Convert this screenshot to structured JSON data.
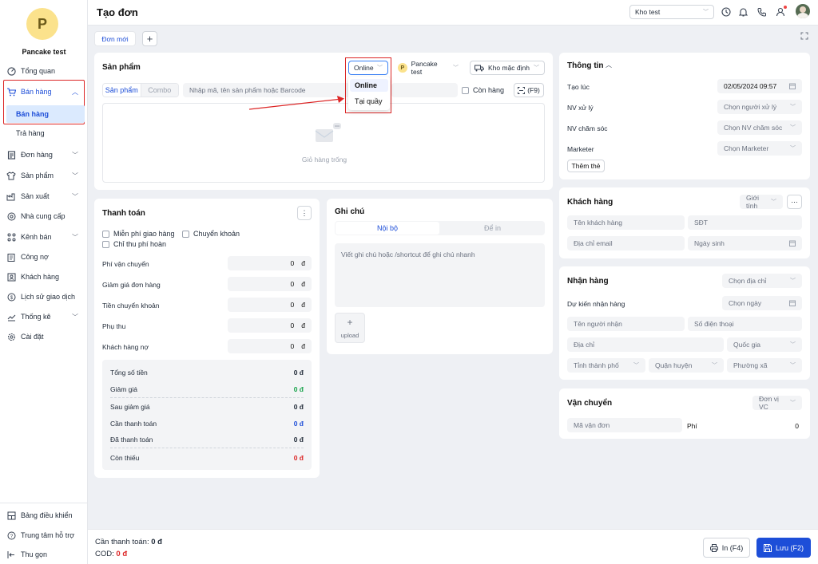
{
  "sidebar": {
    "avatar_letter": "P",
    "shop_name": "Pancake test",
    "items": [
      {
        "label": "Tổng quan"
      },
      {
        "label": "Bán hàng"
      },
      {
        "label": "Bán hàng"
      },
      {
        "label": "Trả hàng"
      },
      {
        "label": "Đơn hàng"
      },
      {
        "label": "Sản phẩm"
      },
      {
        "label": "Sản xuất"
      },
      {
        "label": "Nhà cung cấp"
      },
      {
        "label": "Kênh bán"
      },
      {
        "label": "Công nợ"
      },
      {
        "label": "Khách hàng"
      },
      {
        "label": "Lịch sử giao dịch"
      },
      {
        "label": "Thống kê"
      },
      {
        "label": "Cài đặt"
      }
    ],
    "bottom": [
      {
        "label": "Bảng điều khiển"
      },
      {
        "label": "Trung tâm hỗ trợ"
      },
      {
        "label": "Thu gọn"
      }
    ]
  },
  "header": {
    "title": "Tạo đơn",
    "warehouse": "Kho test"
  },
  "tabs": {
    "new_order": "Đơn mới",
    "add": "+"
  },
  "products": {
    "title": "Sản phẩm",
    "channel": "Online",
    "channel_options": [
      "Online",
      "Tại quầy"
    ],
    "shop": "Pancake test",
    "shop_letter": "P",
    "warehouse": "Kho mặc định",
    "tab_product": "Sản phẩm",
    "tab_combo": "Combo",
    "search_placeholder": "Nhập mã, tên sản phẩm hoặc Barcode",
    "in_stock": "Còn hàng",
    "scan_label": "(F9)",
    "empty_cart": "Giỏ hàng trống"
  },
  "payment": {
    "title": "Thanh toán",
    "free_ship": "Miễn phí giao hàng",
    "transfer": "Chuyển khoản",
    "refund_fee": "Chỉ thu phí hoàn",
    "rows": [
      {
        "label": "Phí vận chuyển",
        "value": "0",
        "unit": "đ"
      },
      {
        "label": "Giảm giá đơn hàng",
        "value": "0",
        "unit": "đ"
      },
      {
        "label": "Tiền chuyển khoản",
        "value": "0",
        "unit": "đ"
      },
      {
        "label": "Phụ thu",
        "value": "0",
        "unit": "đ"
      },
      {
        "label": "Khách hàng nợ",
        "value": "0",
        "unit": "đ"
      }
    ],
    "summary": [
      {
        "label": "Tổng số tiền",
        "value": "0 đ"
      },
      {
        "label": "Giảm giá",
        "value": "0 đ"
      },
      {
        "label": "Sau giảm giá",
        "value": "0 đ"
      },
      {
        "label": "Cần thanh toán",
        "value": "0 đ"
      },
      {
        "label": "Đã thanh toán",
        "value": "0 đ"
      },
      {
        "label": "Còn thiếu",
        "value": "0 đ"
      }
    ]
  },
  "notes": {
    "title": "Ghi chú",
    "tab_internal": "Nội bộ",
    "tab_print": "Để in",
    "placeholder": "Viết ghi chú hoặc /shortcut để ghi chú nhanh",
    "upload_plus": "+",
    "upload": "upload"
  },
  "info": {
    "title": "Thông tin",
    "created_label": "Tạo lúc",
    "created_value": "02/05/2024 09:57",
    "handler_label": "NV xử lý",
    "handler_value": "Chọn người xử lý",
    "care_label": "NV chăm sóc",
    "care_value": "Chọn NV chăm sóc",
    "marketer_label": "Marketer",
    "marketer_value": "Chọn Marketer",
    "add_tag": "Thêm thẻ"
  },
  "customer": {
    "title": "Khách hàng",
    "gender": "Giới tính",
    "name_ph": "Tên khách hàng",
    "phone_ph": "SĐT",
    "email_ph": "Địa chỉ email",
    "dob_ph": "Ngày sinh"
  },
  "receive": {
    "title": "Nhận hàng",
    "choose_address": "Chọn địa chỉ",
    "expected_label": "Dự kiến nhận hàng",
    "choose_date": "Chọn ngày",
    "receiver_ph": "Tên người nhận",
    "phone_ph": "Số điện thoại",
    "address_ph": "Địa chỉ",
    "country_ph": "Quốc gia",
    "province_ph": "Tỉnh thành phố",
    "district_ph": "Quận huyện",
    "ward_ph": "Phường xã"
  },
  "shipping": {
    "title": "Vận chuyển",
    "carrier": "Đơn vị VC",
    "tracking_ph": "Mã vận đơn",
    "fee_label": "Phí",
    "fee_value": "0"
  },
  "footer": {
    "need_pay_label": "Cần thanh toán:",
    "need_pay_value": "0 đ",
    "cod_label": "COD:",
    "cod_value": "0 đ",
    "print": "In (F4)",
    "save": "Lưu (F2)"
  },
  "colors": {
    "accent": "#1d4ed8",
    "highlight": "#dc2626",
    "active_bg": "#dbeafe"
  }
}
